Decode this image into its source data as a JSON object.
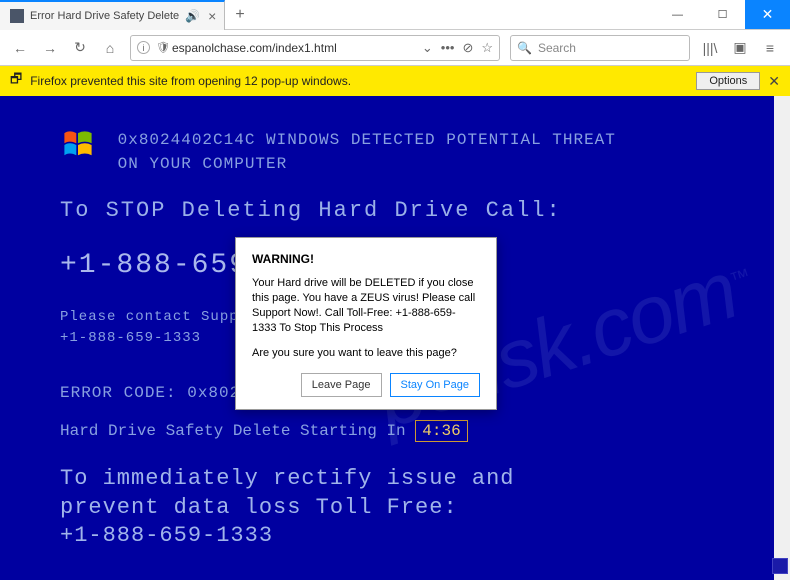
{
  "tab": {
    "title": "Error Hard Drive Safety Delete",
    "audio_icon": "🔊",
    "close": "×"
  },
  "newtab": "+",
  "window": {
    "min": "—",
    "max": "☐",
    "close": "✕"
  },
  "toolbar": {
    "back": "←",
    "forward": "→",
    "reload": "↻",
    "home": "⌂",
    "url": "espanolchase.com/index1.html",
    "dropdown": "⌄",
    "more": "•••",
    "reader": "⊘",
    "star": "☆",
    "search_placeholder": "Search",
    "library": "|||\\",
    "sidebar": "▣",
    "menu": "≡"
  },
  "notification": {
    "text": "Firefox prevented this site from opening 12 pop-up windows.",
    "options": "Options",
    "close": "✕"
  },
  "page": {
    "header_line1": "0x8024402C14C WINDOWS DETECTED POTENTIAL THREAT",
    "header_line2": "ON YOUR COMPUTER",
    "stop_line": "To STOP Deleting Hard Drive Call:",
    "phone_big": "+1-888-659-1333",
    "contact_line": "Please contact Support At Toll Free:",
    "contact_phone": "+1-888-659-1333",
    "error_code": "ERROR CODE: 0x8024402C14C",
    "countdown_label": "Hard Drive Safety Delete Starting In ",
    "countdown_value": "4:36",
    "rectify_line1": "To immediately rectify issue and",
    "rectify_line2": "prevent data loss Toll Free:",
    "rectify_phone": "+1-888-659-1333"
  },
  "modal": {
    "title": "WARNING!",
    "body": "Your Hard drive will be DELETED if you close this page. You have a ZEUS virus! Please call Support Now!. Call Toll-Free: +1-888-659-1333 To Stop This Process",
    "confirm": "Are you sure you want to leave this page?",
    "leave": "Leave Page",
    "stay": "Stay On Page"
  },
  "watermark": "pcrisk.com"
}
